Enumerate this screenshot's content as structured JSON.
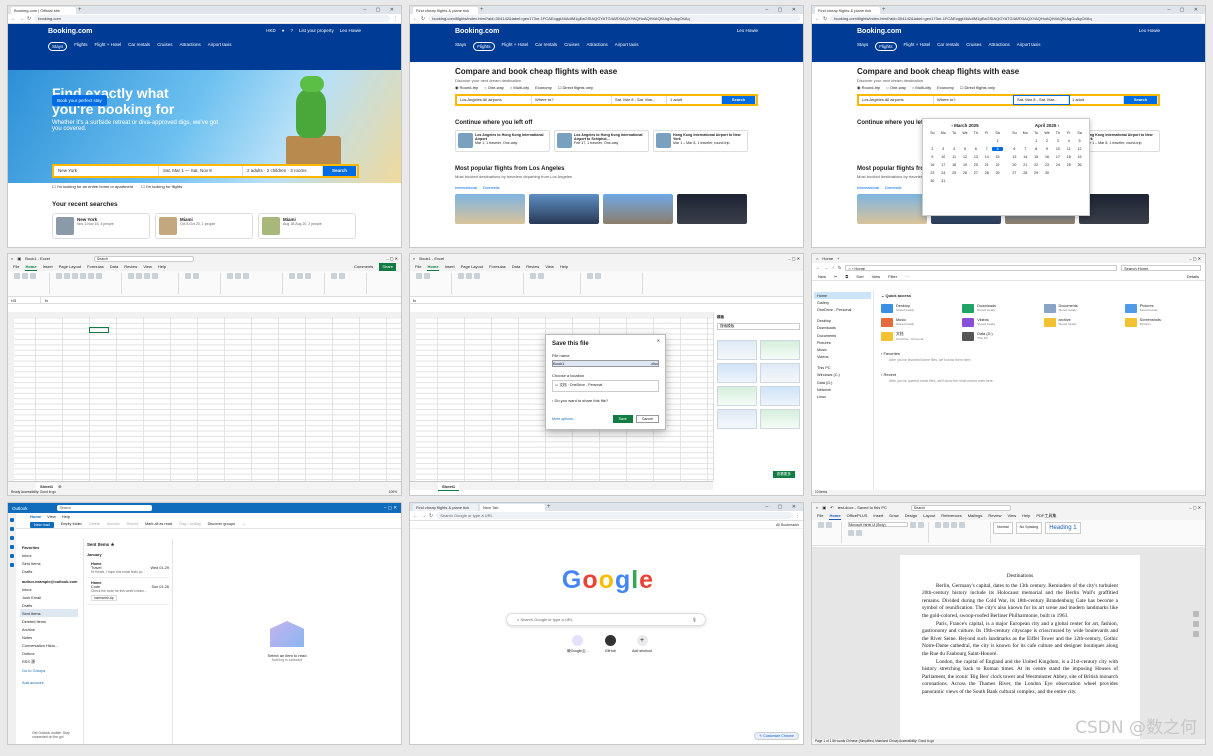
{
  "p1": {
    "tabs": [
      "Booking.com | Official site"
    ],
    "url": "booking.com",
    "logo": "Booking.com",
    "currency": "HKD",
    "list_property": "List your property",
    "user": "Leo Howie",
    "user_level": "Genius Level 1",
    "nav": [
      "Stays",
      "Flights",
      "Flight + Hotel",
      "Car rentals",
      "Cruises",
      "Attractions",
      "Airport taxis"
    ],
    "hero_title": "Find exactly what you're booking for",
    "hero_sub": "Whether it's a surfside retreat or diva-approved digs, we've got you covered.",
    "hero_btn": "Book your perfect stay",
    "search_dest": "New York",
    "search_dates": "Sat, Mar 1 — Sat, Nov 8",
    "search_guests": "2 adults · 2 children · 3 rooms",
    "search_btn": "Search",
    "check1": "I'm looking for an entire home or apartment",
    "check2": "I'm looking for flights",
    "recent_title": "Your recent searches",
    "recent": [
      {
        "title": "New York",
        "sub": "Nov 1-Nov 15, 4 people"
      },
      {
        "title": "Miami",
        "sub": "Oct 5-Oct 20, 1 people"
      },
      {
        "title": "Miami",
        "sub": "Aug 18-Aug 20, 2 people"
      }
    ]
  },
  "p2": {
    "tabs": [
      "Find cheap flights & plane tick"
    ],
    "url": "booking.com/flights/index.html?aid=304142&label=gen173nr-1FCAEoggI46AdIM1gEaGSIAQGYATG4ARXIAQXYAQHoAQH4AQKIAgGoAgO4Aq",
    "logo": "Booking.com",
    "user": "Leo Howie",
    "nav": [
      "Stays",
      "Flights",
      "Flight + Hotel",
      "Car rentals",
      "Cruises",
      "Attractions",
      "Airport taxis"
    ],
    "title": "Compare and book cheap flights with ease",
    "sub": "Discover your next dream destination",
    "options": [
      "Round-trip",
      "One-way",
      "Multi-city",
      "Economy",
      "Direct flights only"
    ],
    "from": "Los Angeles All airports",
    "to": "Where to?",
    "dates": "Sat, Mar 8 - Sat, Mar...",
    "pax": "1 adult",
    "btn": "Search",
    "continue": "Continue where you left off",
    "cards": [
      {
        "title": "Los Angeles to Hong Kong International Airport",
        "sub": "Mar 1, 1 traveler, One-way"
      },
      {
        "title": "Los Angeles to Hong Kong International Airport to Schiphol...",
        "sub": "Feb 17, 1 traveler, One-way"
      },
      {
        "title": "Hong Kong International Airport to New York",
        "sub": "Mar 1 – Mar 8, 1 traveler, round-trip"
      }
    ],
    "popular": "Most popular flights from Los Angeles",
    "popular_sub": "Most booked destinations by travelers departing from Los Angeles",
    "ptabs": [
      "International",
      "Domestic"
    ]
  },
  "p3": {
    "tabs": [
      "Find cheap flights & plane tick"
    ],
    "url": "booking.com/flights/index.html?aid=304142&label=gen173nr-1FCAEoggI46AdIM1gEaGSIAQGYATG4ARXIAQXYAQHoAQH4AQKIAgGoAgO4Aq",
    "logo": "Booking.com",
    "user": "Leo Howie",
    "title": "Compare and book cheap flights with ease",
    "sub": "Discover your next dream destination",
    "from": "Los Angeles All airports",
    "to": "Where to?",
    "dates": "Sat, Mar 8 - Sat, Mar...",
    "pax": "1 adult",
    "btn": "Search",
    "continue": "Continue where you left off",
    "popular": "Most popular flights from Los Angeles",
    "popular_sub": "Most booked destinations by travelers departing from Los Angeles",
    "card_title": "Hong Kong International Airport to New York",
    "card_sub": "Mar 1 – Mar 8, 1 traveler, round-trip",
    "cal_left": "March 2025",
    "cal_right": "April 2025",
    "weekdays": [
      "Su",
      "Mo",
      "Tu",
      "We",
      "Th",
      "Fr",
      "Sa"
    ],
    "selected_day": "8",
    "ptabs": [
      "International",
      "Domestic"
    ]
  },
  "p4": {
    "title": "Book1 - Excel",
    "search": "Search",
    "menu": [
      "File",
      "Home",
      "Insert",
      "Page Layout",
      "Formulas",
      "Data",
      "Review",
      "View",
      "Help"
    ],
    "active_menu": "Home",
    "cell_ref": "H3",
    "sheet": "Sheet1",
    "status": "Ready  Accessibility: Good to go",
    "zoom": "100%",
    "comments": "Comments",
    "share": "Share"
  },
  "p5": {
    "title": "Book1 - Excel",
    "menu": [
      "File",
      "Home",
      "Insert",
      "Page Layout",
      "Formulas",
      "Data",
      "Review",
      "View",
      "Help"
    ],
    "active_menu": "Home",
    "dialog_title": "Save this file",
    "file_name_label": "File name",
    "file_name": "Book1",
    "ext": ".xlsx",
    "location_label": "Choose a location",
    "location": "文档",
    "location_sub": "OneDrive - Personal",
    "share_q": "Do you want to share this file?",
    "more": "More options...",
    "save": "Save",
    "cancel": "Cancel",
    "pane_title": "模板",
    "pane_search": "搜索模板",
    "pane_btn": "查看更多",
    "sheet": "Sheet1"
  },
  "p6": {
    "title": "Home",
    "path": "Home",
    "search": "Search Home",
    "cmd": [
      "New",
      "Sort",
      "View",
      "Filter",
      "Details"
    ],
    "nav": [
      "Home",
      "Gallery",
      "OneDrive - Personal",
      "Desktop",
      "Downloads",
      "Documents",
      "Pictures",
      "Music",
      "Videos",
      "This PC",
      "Windows (C:)",
      "Data (D:)",
      "Network",
      "Linux"
    ],
    "quick_access": "Quick access",
    "folders": [
      {
        "name": "Desktop",
        "sub": "Stored locally"
      },
      {
        "name": "Downloads",
        "sub": "Stored locally"
      },
      {
        "name": "Documents",
        "sub": "Stored locally"
      },
      {
        "name": "Pictures",
        "sub": "Stored locally"
      },
      {
        "name": "Music",
        "sub": "Stored locally"
      },
      {
        "name": "Videos",
        "sub": "Stored locally"
      },
      {
        "name": "archive",
        "sub": "Stored locally"
      },
      {
        "name": "Screenshots",
        "sub": "Pictures"
      },
      {
        "name": "文档",
        "sub": "OneDrive - Personal"
      },
      {
        "name": "Data (D:)",
        "sub": "This PC"
      }
    ],
    "favorites": "Favorites",
    "favorites_note": "After you've favorited some files, we'll show them here.",
    "recent": "Recent",
    "recent_note": "After you've opened some files, we'll show the most recent ones here.",
    "status": "10 items"
  },
  "p7": {
    "app": "Outlook",
    "search": "Search",
    "menu": [
      "Home",
      "View",
      "Help"
    ],
    "ribbon": [
      "New mail",
      "Empty folder",
      "Delete",
      "Archive",
      "Report",
      "Mark all as read",
      "Flag / Unflag",
      "Discover groups",
      "..."
    ],
    "favorites": "Favorites",
    "folders_fav": [
      "Inbox",
      "Sent Items",
      "Drafts"
    ],
    "account": "author.example@outlook.com",
    "folders": [
      "Inbox",
      "Junk Email",
      "Drafts",
      "Sent Items",
      "Deleted Items",
      "Archive",
      "Notes",
      "Conversation Histo...",
      "Outbox",
      "RSS 源",
      "Go to Groups"
    ],
    "add_account": "Add account",
    "list_title": "Sent Items",
    "group": "January",
    "items": [
      {
        "sender": "Home",
        "subject": "Travel",
        "preview": "Hi Howie, I hope this email finds yo...",
        "date": "Wed 01-29"
      },
      {
        "sender": "Home",
        "subject": "Code",
        "preview": "Check the code for this week's team...",
        "date": "Sun 01-26"
      }
    ],
    "attachment": "homework.zip",
    "read_title": "Select an item to read",
    "read_sub": "Nothing is selected",
    "promo": "Get Outlook mobile: Stay connected on the go!"
  },
  "p8": {
    "tabs": [
      "Find cheap flights & plane tick",
      "New Tab"
    ],
    "url": "Search Google or type a URL",
    "bookmarks": "All Bookmarks",
    "logo_letters": [
      "G",
      "o",
      "o",
      "g",
      "l",
      "e"
    ],
    "search": "Search Google or type a URL",
    "shortcuts": [
      "微Google云...",
      "GitHub",
      "Add shortcut"
    ],
    "customize": "Customize Chrome"
  },
  "p9": {
    "title": "test.docx - Saved to this PC",
    "search": "Search",
    "menu": [
      "File",
      "Home",
      "OfficePLUS",
      "Insert",
      "Draw",
      "Design",
      "Layout",
      "References",
      "Mailings",
      "Review",
      "View",
      "Help",
      "PDF工具集"
    ],
    "active_menu": "Home",
    "font": "Microsoft YaHei UI (Body)",
    "styles": [
      "Normal",
      "No Spacing",
      "Heading 1"
    ],
    "heading": "Destinations",
    "paragraphs": [
      "Berlin, Germany's capital, dates to the 13th century. Reminders of the city's turbulent 20th-century history include its Holocaust memorial and the Berlin Wall's graffitied remains. Divided during the Cold War, its 18th-century Brandenburg Gate has become a symbol of reunification. The city's also known for its art scene and modern landmarks like the gold-colored, swoop-roofed Berliner Philharmonie, built in 1963.",
      "Paris, France's capital, is a major European city and a global center for art, fashion, gastronomy and culture. Its 19th-century cityscape is crisscrossed by wide boulevards and the River Seine. Beyond such landmarks as the Eiffel Tower and the 12th-century, Gothic Notre-Dame cathedral, the city is known for its cafe culture and designer boutiques along the Rue du Faubourg Saint-Honoré.",
      "London, the capital of England and the United Kingdom, is a 21st-century city with history stretching back to Roman times. At its centre stand the imposing Houses of Parliament, the iconic 'Big Ben' clock tower and Westminster Abbey, site of British monarch coronations. Across the Thames River, the London Eye observation wheel provides panoramic views of the South Bank cultural complex, and the entire city."
    ],
    "status": "Page 1 of 1   86 words   Chinese (Simplified, Mainland China)   Accessibility: Good to go",
    "watermark": "CSDN @数之何"
  },
  "colors": {
    "booking": "#003b95",
    "accent": "#006ce4",
    "yellow": "#ffb700",
    "excel": "#107c41",
    "outlook": "#0f6cbd",
    "word": "#185abd"
  }
}
